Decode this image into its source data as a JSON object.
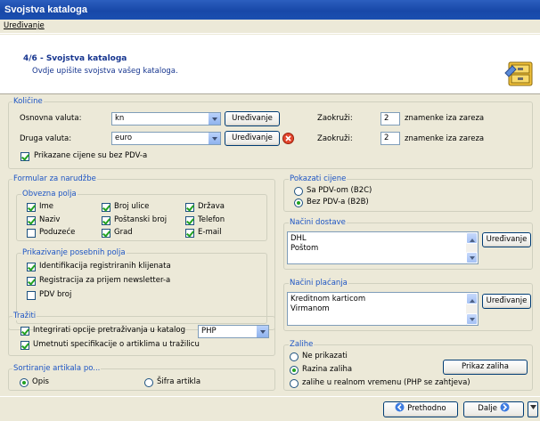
{
  "window": {
    "title": "Svojstva kataloga"
  },
  "menu": {
    "edit_label": "Uređivanje"
  },
  "header": {
    "step_title": "4/6 - Svojstva kataloga",
    "subtitle": "Ovdje upišite svojstva vašeg kataloga.",
    "icon": "cabinet-icon"
  },
  "kolicine": {
    "title": "Količine",
    "base_currency_label": "Osnovna valuta:",
    "base_currency_value": "kn",
    "other_currency_label": "Druga valuta:",
    "other_currency_value": "euro",
    "edit_label": "Uređivanje",
    "round_label": "Zaokruži:",
    "round1_value": "2",
    "round2_value": "2",
    "decimals_text": "znamenke iza zareza",
    "prices_pdv_label": "Prikazane cijene su bez PDV-a"
  },
  "formular": {
    "title": "Formular za narudžbe",
    "required": {
      "title": "Obvezna polja",
      "items": [
        {
          "label": "Ime",
          "checked": true
        },
        {
          "label": "Naziv",
          "checked": true
        },
        {
          "label": "Poduzeće",
          "checked": false
        },
        {
          "label": "Broj ulice",
          "checked": true
        },
        {
          "label": "Poštanski broj",
          "checked": true
        },
        {
          "label": "Grad",
          "checked": true
        },
        {
          "label": "Država",
          "checked": true
        },
        {
          "label": "Telefon",
          "checked": true
        },
        {
          "label": "E-mail",
          "checked": true
        }
      ]
    },
    "special": {
      "title": "Prikazivanje posebnih polja",
      "items": [
        {
          "label": "Identifikacija registriranih klijenata",
          "checked": true
        },
        {
          "label": "Registracija za prijem newsletter-a",
          "checked": true
        },
        {
          "label": "PDV broj",
          "checked": false
        }
      ]
    }
  },
  "search": {
    "title": "Tražiti",
    "integrate_label": "Integrirati opcije pretraživanja u katalog",
    "integrate_value": "PHP",
    "specs_label": "Umetnuti specifikacije o artiklima u tražilicu"
  },
  "sort": {
    "title": "Sortiranje artikala po...",
    "opt1": "Opis",
    "opt2": "Šifra artikla"
  },
  "prices": {
    "title": "Pokazati cijene",
    "opt1": "Sa PDV-om (B2C)",
    "opt2": "Bez PDV-a (B2B)"
  },
  "delivery": {
    "title": "Načini dostave",
    "items": [
      "DHL",
      "Poštom"
    ],
    "edit_label": "Uređivanje"
  },
  "payment": {
    "title": "Načini plaćanja",
    "items": [
      "Kreditnom karticom",
      "Virmanom"
    ],
    "edit_label": "Uređivanje"
  },
  "stock": {
    "title": "Zalihe",
    "opt1": "Ne prikazati",
    "opt2": "Razina zaliha",
    "opt3": "zalihe u realnom vremenu (PHP se zahtjeva)",
    "show_button": "Prikaz zaliha"
  },
  "nav": {
    "prev": "Prethodno",
    "next": "Dalje"
  }
}
